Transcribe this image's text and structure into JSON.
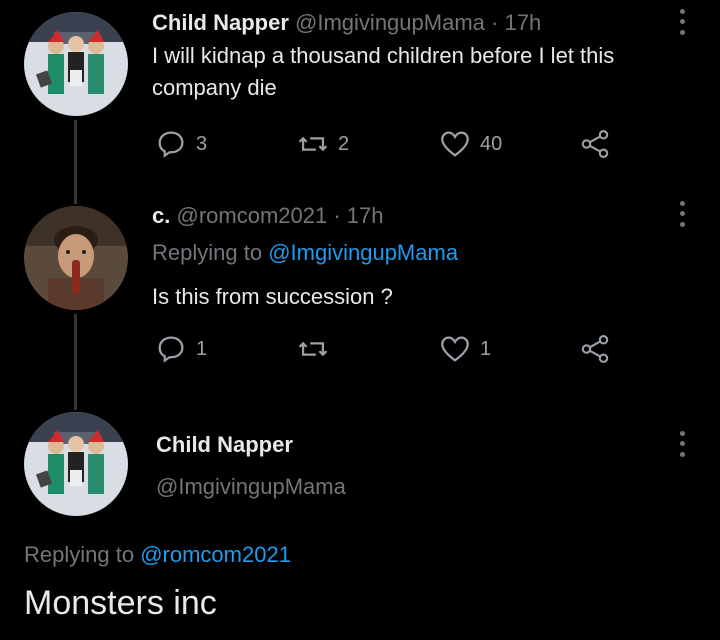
{
  "tweets": [
    {
      "display_name": "Child Napper",
      "handle": "@ImgivingupMama",
      "separator": "·",
      "time": "17h",
      "text": "I will kidnap a thousand children before I let this company die",
      "actions": {
        "replies": "3",
        "retweets": "2",
        "likes": "40"
      }
    },
    {
      "display_name": "c.",
      "handle": "@romcom2021",
      "separator": "·",
      "time": "17h",
      "replying_prefix": "Replying to",
      "replying_to": "@ImgivingupMama",
      "text": "Is this from succession ?",
      "actions": {
        "replies": "1",
        "retweets": "",
        "likes": "1"
      }
    }
  ],
  "focused_tweet": {
    "display_name": "Child Napper",
    "handle": "@ImgivingupMama",
    "replying_prefix": "Replying to",
    "replying_to": "@romcom2021",
    "text": "Monsters inc"
  },
  "icons": {
    "reply": "reply-icon",
    "retweet": "retweet-icon",
    "like": "heart-icon",
    "share": "share-icon",
    "more": "more-vertical-icon"
  },
  "colors": {
    "background": "#000000",
    "primary_text": "#e7e9ea",
    "secondary_text": "#71767b",
    "mention": "#1d9bf0",
    "thread_line": "#333639"
  }
}
